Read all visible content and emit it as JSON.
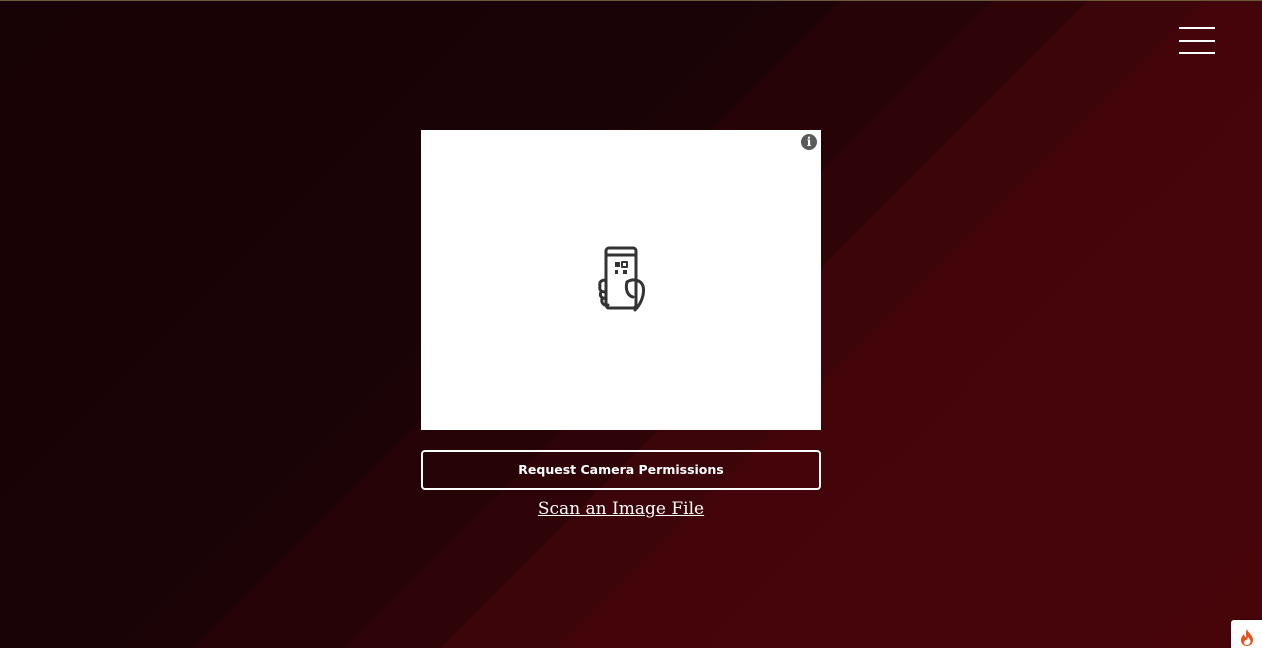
{
  "header": {
    "menu_icon": "hamburger-menu-icon"
  },
  "scanner": {
    "info_icon": "info-icon",
    "info_glyph": "i",
    "placeholder_icon": "phone-qr-scan-icon"
  },
  "actions": {
    "request_camera_label": "Request Camera Permissions",
    "scan_image_file_label": "Scan an Image File"
  },
  "badge": {
    "icon": "flame-icon",
    "color": "#e4531c"
  },
  "colors": {
    "background_dark": "#170205",
    "background_red": "#47050a",
    "button_border": "#ffffff"
  }
}
